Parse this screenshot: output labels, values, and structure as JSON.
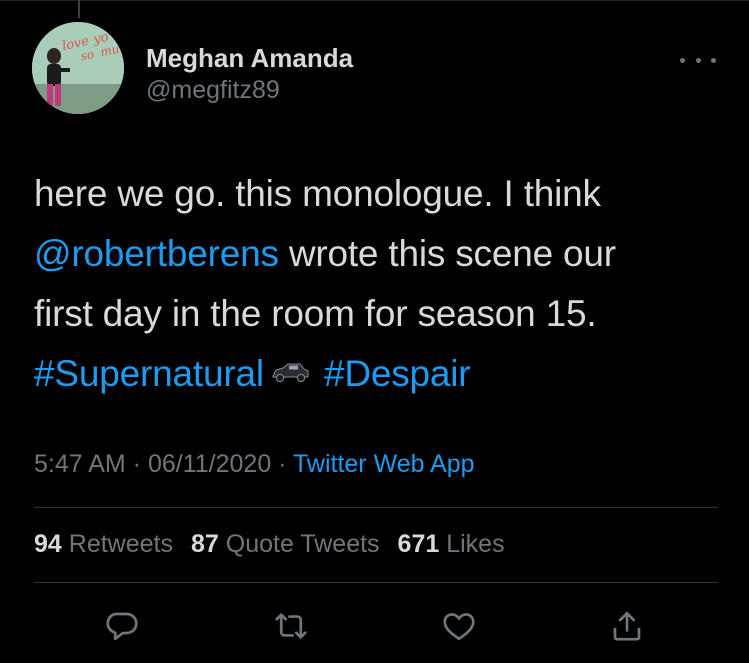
{
  "tweet": {
    "author": {
      "display_name": "Meghan Amanda",
      "handle": "@megfitz89",
      "avatar_sign_text": "love you so much"
    },
    "text_lines": [
      [
        {
          "type": "text",
          "value": "here we go. this monologue. I think"
        }
      ],
      [
        {
          "type": "mention",
          "value": "@robertberens"
        },
        {
          "type": "text",
          "value": " wrote this scene our"
        }
      ],
      [
        {
          "type": "text",
          "value": "first day in the room for season 15."
        }
      ],
      [
        {
          "type": "hashtag",
          "value": "#Supernatural"
        },
        {
          "type": "emoji",
          "value": "car-emoji"
        },
        {
          "type": "hashtag",
          "value": "#Despair"
        }
      ]
    ],
    "meta": {
      "time": "5:47 AM",
      "separator": " · ",
      "date": "06/11/2020",
      "source": "Twitter Web App"
    },
    "stats": {
      "retweets": {
        "count": "94",
        "label": "Retweets"
      },
      "quote_tweets": {
        "count": "87",
        "label": "Quote Tweets"
      },
      "likes": {
        "count": "671",
        "label": "Likes"
      }
    },
    "actions": [
      "reply-icon",
      "retweet-icon",
      "like-icon",
      "share-icon"
    ]
  },
  "colors": {
    "background": "#000000",
    "text": "#D9D9D9",
    "secondary": "#6E767D",
    "link": "#1D9BF0",
    "divider": "#2F3336"
  }
}
